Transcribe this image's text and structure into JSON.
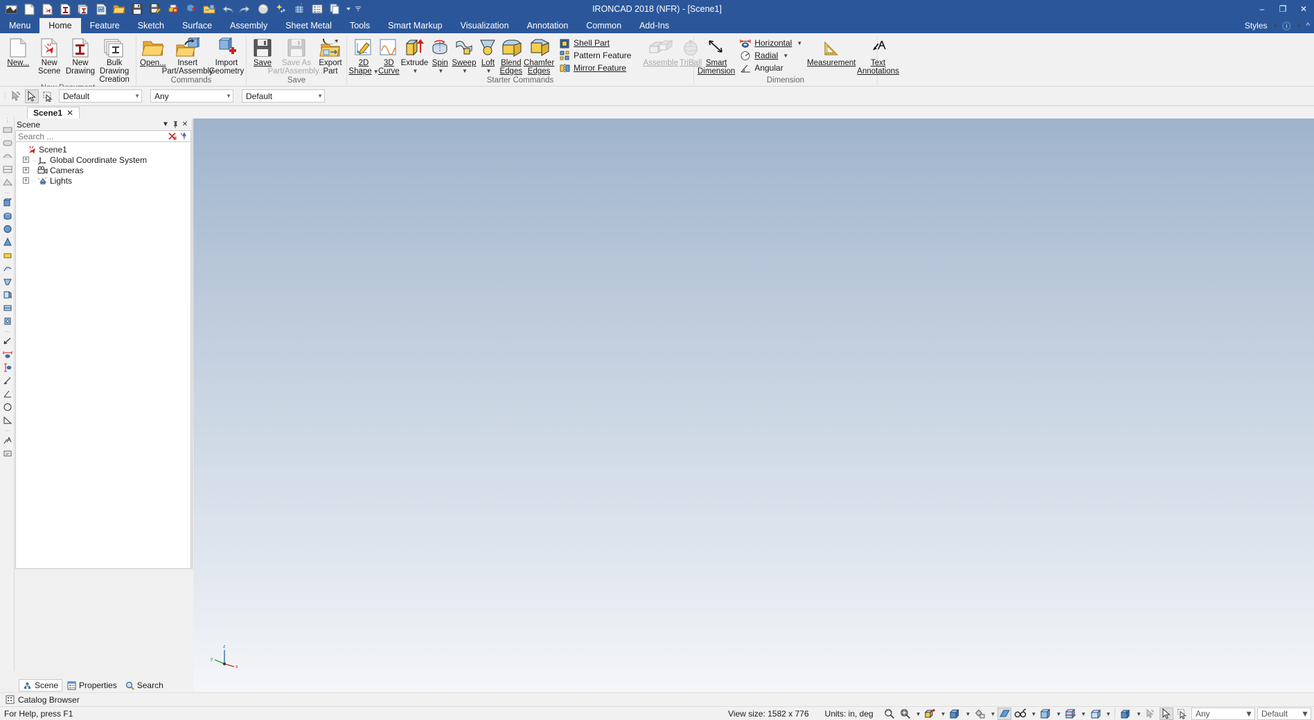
{
  "window": {
    "title": "IRONCAD 2018 (NFR) - [Scene1]",
    "minimize": "–",
    "maximize": "❐",
    "close": "✕"
  },
  "quick_access": [
    {
      "name": "ironcad-logo-icon",
      "label": "IronCAD"
    },
    {
      "name": "new-document-icon",
      "label": "New"
    },
    {
      "name": "new-scene-icon",
      "label": "New Scene"
    },
    {
      "name": "new-drawing-icon",
      "label": "New Drawing"
    },
    {
      "name": "bulk-drawing-icon",
      "label": "Bulk Drawing Creation"
    },
    {
      "name": "new-sheet-icon",
      "label": "New Sheet"
    },
    {
      "name": "open-icon",
      "label": "Open"
    },
    {
      "name": "save-icon",
      "label": "Save"
    },
    {
      "name": "save-as-icon",
      "label": "Save As"
    },
    {
      "name": "print-icon",
      "label": "Print"
    },
    {
      "name": "insert-part-icon",
      "label": "Insert Part"
    },
    {
      "name": "import-geometry-icon",
      "label": "Import Geometry"
    },
    {
      "name": "undo-icon",
      "label": "Undo"
    },
    {
      "name": "redo-icon",
      "label": "Redo"
    },
    {
      "name": "render-icon",
      "label": "Render"
    },
    {
      "name": "effects-icon",
      "label": "Effects"
    },
    {
      "name": "grid-icon",
      "label": "Grid"
    },
    {
      "name": "properties-icon",
      "label": "Properties"
    },
    {
      "name": "copy-icon",
      "label": "Copy"
    },
    {
      "name": "customize-qat-icon",
      "label": "Customize Quick Access Toolbar"
    }
  ],
  "menu_tabs": [
    {
      "label": "Menu",
      "active": false
    },
    {
      "label": "Home",
      "active": true
    },
    {
      "label": "Feature",
      "active": false
    },
    {
      "label": "Sketch",
      "active": false
    },
    {
      "label": "Surface",
      "active": false
    },
    {
      "label": "Assembly",
      "active": false
    },
    {
      "label": "Sheet Metal",
      "active": false
    },
    {
      "label": "Tools",
      "active": false
    },
    {
      "label": "Smart Markup",
      "active": false
    },
    {
      "label": "Visualization",
      "active": false
    },
    {
      "label": "Annotation",
      "active": false
    },
    {
      "label": "Common",
      "active": false
    },
    {
      "label": "Add-Ins",
      "active": false
    }
  ],
  "menu_right": {
    "styles_label": "Styles",
    "help_label": "?",
    "minimize_ribbon": "⌃"
  },
  "ribbon": {
    "groups": [
      {
        "name": "new-document",
        "label": "New Document",
        "buttons": [
          {
            "name": "new-button",
            "label": "New...",
            "underline": "N",
            "icon": "blank-page-icon",
            "disabled": false
          },
          {
            "name": "new-scene-button",
            "label": "New Scene",
            "icon": "new-scene-icon",
            "disabled": false
          },
          {
            "name": "new-drawing-button",
            "label": "New Drawing",
            "icon": "new-drawing-icon",
            "disabled": false
          },
          {
            "name": "bulk-drawing-creation-button",
            "label": "Bulk Drawing Creation",
            "icon": "bulk-drawing-icon",
            "disabled": false
          }
        ]
      },
      {
        "name": "commands",
        "label": "Commands",
        "buttons": [
          {
            "name": "open-button",
            "label": "Open...",
            "underline": "O",
            "icon": "open-folder-icon",
            "disabled": false
          },
          {
            "name": "insert-part-assembly-button",
            "label": "Insert Part/Assembly",
            "icon": "insert-part-icon",
            "disabled": false
          },
          {
            "name": "import-geometry-button",
            "label": "Import Geometry",
            "icon": "import-geometry-icon",
            "disabled": false
          }
        ]
      },
      {
        "name": "save",
        "label": "Save",
        "buttons": [
          {
            "name": "save-button",
            "label": "Save",
            "underline": "S",
            "icon": "floppy-icon",
            "disabled": false
          },
          {
            "name": "save-as-part-assembly-button",
            "label": "Save As Part/Assembly...",
            "icon": "floppy-gray-icon",
            "disabled": true
          },
          {
            "name": "export-part-button",
            "label": "Export Part",
            "icon": "export-part-icon",
            "disabled": false
          }
        ]
      },
      {
        "name": "starter-commands",
        "label": "Starter Commands",
        "buttons": [
          {
            "name": "2d-shape-button",
            "label": "2D Shape",
            "icon": "2d-shape-icon",
            "dropdown": true
          },
          {
            "name": "3d-curve-button",
            "label": "3D Curve",
            "icon": "3d-curve-icon",
            "dropdown": false
          },
          {
            "name": "extrude-button",
            "label": "Extrude",
            "icon": "extrude-icon",
            "dropdown": true
          },
          {
            "name": "spin-button",
            "label": "Spin",
            "icon": "spin-icon",
            "dropdown": true
          },
          {
            "name": "sweep-button",
            "label": "Sweep",
            "icon": "sweep-icon",
            "dropdown": true
          },
          {
            "name": "loft-button",
            "label": "Loft",
            "icon": "loft-icon",
            "dropdown": true
          },
          {
            "name": "blend-edges-button",
            "label": "Blend Edges",
            "icon": "blend-edges-icon",
            "dropdown": false
          },
          {
            "name": "chamfer-edges-button",
            "label": "Chamfer Edges",
            "icon": "chamfer-edges-icon",
            "dropdown": false
          }
        ],
        "small_buttons": [
          {
            "name": "shell-part-button",
            "label": "Shell Part",
            "icon": "shell-part-icon"
          },
          {
            "name": "pattern-feature-button",
            "label": "Pattern Feature",
            "icon": "pattern-feature-icon"
          },
          {
            "name": "mirror-feature-button",
            "label": "Mirror Feature",
            "icon": "mirror-feature-icon"
          }
        ],
        "trailing_buttons": [
          {
            "name": "assemble-button",
            "label": "Assemble",
            "icon": "assemble-icon",
            "disabled": true
          },
          {
            "name": "triball-button",
            "label": "TriBall",
            "icon": "triball-icon",
            "disabled": true
          }
        ]
      },
      {
        "name": "dimension",
        "label": "Dimension",
        "buttons": [
          {
            "name": "smart-dimension-button",
            "label": "Smart Dimension",
            "icon": "smart-dimension-icon"
          },
          {
            "name": "measurement-button",
            "label": "Measurement",
            "icon": "measurement-icon"
          },
          {
            "name": "text-annotations-button",
            "label": "Text Annotations",
            "icon": "text-annotations-icon"
          }
        ],
        "small_buttons": [
          {
            "name": "horizontal-dimension-button",
            "label": "Horizontal",
            "icon": "horizontal-dimension-icon",
            "dropdown": true
          },
          {
            "name": "radial-dimension-button",
            "label": "Radial",
            "icon": "radial-dimension-icon",
            "dropdown": true
          },
          {
            "name": "angular-dimension-button",
            "label": "Angular",
            "icon": "angular-dimension-icon",
            "dropdown": false
          }
        ]
      }
    ]
  },
  "toolbar2": {
    "select_icon": "select-arrow-icon",
    "pick_icon": "pick-cursor-icon",
    "box_select_icon": "box-select-icon",
    "combo_style": {
      "value": "Default",
      "name": "style-combo"
    },
    "combo_filter": {
      "value": "Any",
      "name": "filter-combo"
    },
    "combo_scope": {
      "value": "Default",
      "name": "scope-combo"
    }
  },
  "scene_tab": {
    "label": "Scene1",
    "close": "✕"
  },
  "browser": {
    "title": "Scene",
    "collapse_icon": "▼",
    "pin_icon": "⚐",
    "close_icon": "✕",
    "search_placeholder": "Search ...",
    "search_value": "",
    "filter_clear_icon": "clear-filter-icon",
    "filter_icon": "tree-filter-icon",
    "tree": [
      {
        "label": "Scene1",
        "icon": "ironcad-scene-icon",
        "level": 0,
        "expandable": false
      },
      {
        "label": "Global Coordinate System",
        "icon": "coordinate-system-icon",
        "level": 1,
        "expandable": true,
        "expanded": false
      },
      {
        "label": "Cameras",
        "icon": "camera-icon",
        "level": 1,
        "expandable": true,
        "expanded": false
      },
      {
        "label": "Lights",
        "icon": "light-icon",
        "level": 1,
        "expandable": true,
        "expanded": false
      }
    ]
  },
  "panel_tabs": [
    {
      "label": "Scene",
      "icon": "scene-tree-icon",
      "active": true
    },
    {
      "label": "Properties",
      "icon": "properties-icon",
      "active": false
    },
    {
      "label": "Search",
      "icon": "search-icon",
      "active": false
    }
  ],
  "catalog_bar": {
    "label": "Catalog Browser",
    "icon": "catalog-icon"
  },
  "viewport": {
    "triad": {
      "x_label": "x",
      "y_label": "y",
      "z_label": "z"
    }
  },
  "status_bar": {
    "help_text": "For Help, press F1",
    "view_size": "View size: 1582 x  776",
    "units": "Units: in, deg",
    "buttons": [
      {
        "name": "zoom-area-button",
        "icon": "zoom-area-icon",
        "dropdown": false
      },
      {
        "name": "zoom-fit-button",
        "icon": "zoom-fit-icon",
        "dropdown": true
      },
      {
        "name": "view-orientation-button",
        "icon": "view-cube-orient-icon",
        "dropdown": true
      },
      {
        "name": "standard-views-button",
        "icon": "view-cube-icon",
        "dropdown": true
      },
      {
        "name": "camera-button",
        "icon": "camera-view-icon",
        "dropdown": true
      },
      {
        "name": "shading-button",
        "icon": "shade-icon",
        "dropdown": false
      },
      {
        "name": "render-mode-button",
        "icon": "glasses-icon",
        "dropdown": true
      },
      {
        "name": "display-style-button",
        "icon": "display-style-icon",
        "dropdown": true
      },
      {
        "name": "section-button",
        "icon": "section-cube-icon",
        "dropdown": true
      },
      {
        "name": "print-preview-button",
        "icon": "print-preview-icon",
        "dropdown": true
      },
      {
        "name": "snap-button",
        "icon": "snap-icon",
        "dropdown": false
      },
      {
        "name": "cursor-button",
        "icon": "cursor-icon",
        "dropdown": false
      },
      {
        "name": "select-box-button",
        "icon": "select-box-icon",
        "dropdown": false
      }
    ],
    "combo_any": {
      "value": "Any",
      "name": "status-filter-combo"
    },
    "combo_default": {
      "value": "Default",
      "name": "status-style-combo"
    }
  }
}
